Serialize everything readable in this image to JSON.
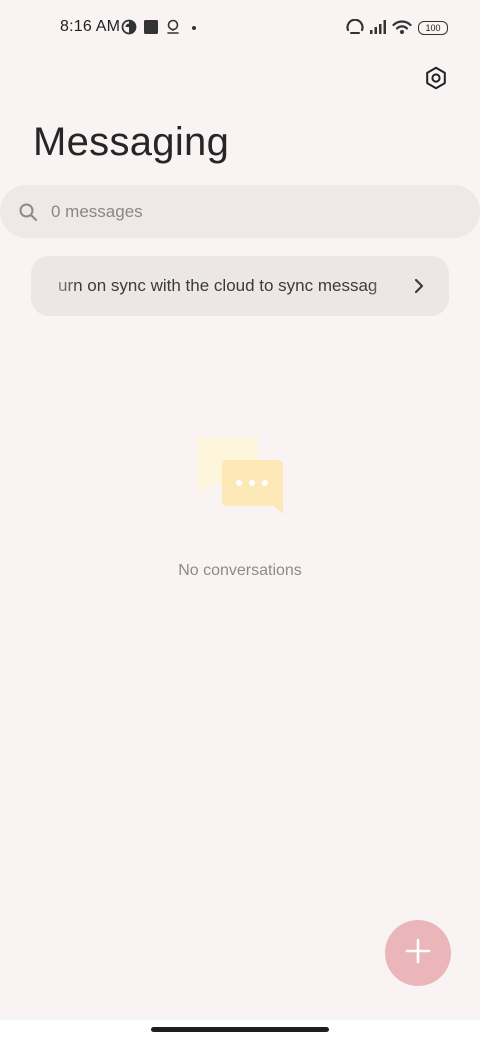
{
  "status_bar": {
    "time": "8:16 AM",
    "battery_level": "100",
    "icons": [
      "circle-half-icon",
      "square-icon",
      "location-pin-icon",
      "dot-icon",
      "hotspot-icon",
      "signal-icon",
      "wifi-icon",
      "battery-icon"
    ]
  },
  "header": {
    "title": "Messaging",
    "settings_icon": "settings-icon"
  },
  "search": {
    "placeholder": "0 messages",
    "icon": "search-icon"
  },
  "sync_banner": {
    "text": "urn on sync with the cloud to sync messag",
    "icon": "chevron-right-icon"
  },
  "empty_state": {
    "text": "No conversations",
    "icon": "chat-bubbles-icon"
  },
  "fab": {
    "icon": "plus-icon"
  },
  "colors": {
    "background": "#faf3f3",
    "search_background": "#efe8e8",
    "banner_background": "#ede6e6",
    "fab": "#ebb6ba",
    "illustration_back": "#fdf3d6",
    "illustration_front": "#fde6b4"
  }
}
